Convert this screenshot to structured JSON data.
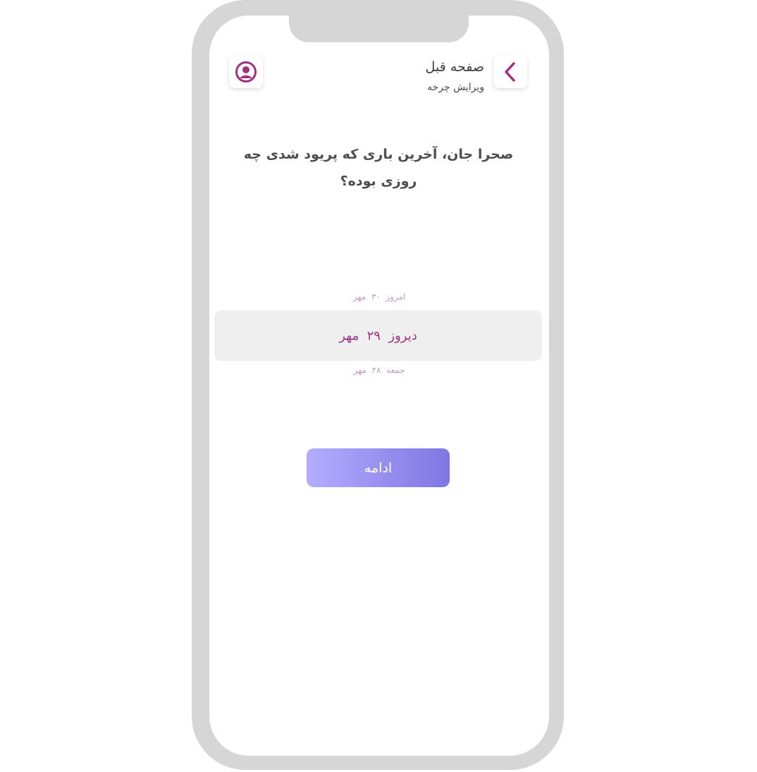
{
  "header": {
    "title": "صفحه قبل",
    "subtitle": "ویرایش چرخه",
    "back_icon": "chevron-left-icon",
    "profile_icon": "user-circle-icon"
  },
  "question": "صحرا جان، آخرین باری که پریود شدی چه روزی بوده؟",
  "picker": {
    "previous": "امروز  ۳۰  مهر",
    "selected": "دیروز  ۲۹  مهر",
    "next": "جمعه  ۲۸  مهر"
  },
  "continue_label": "ادامه",
  "colors": {
    "accent": "#a0307f",
    "button_gradient_start": "#b3adfe",
    "button_gradient_end": "#7f76e2",
    "frame": "#d6d6d6"
  }
}
